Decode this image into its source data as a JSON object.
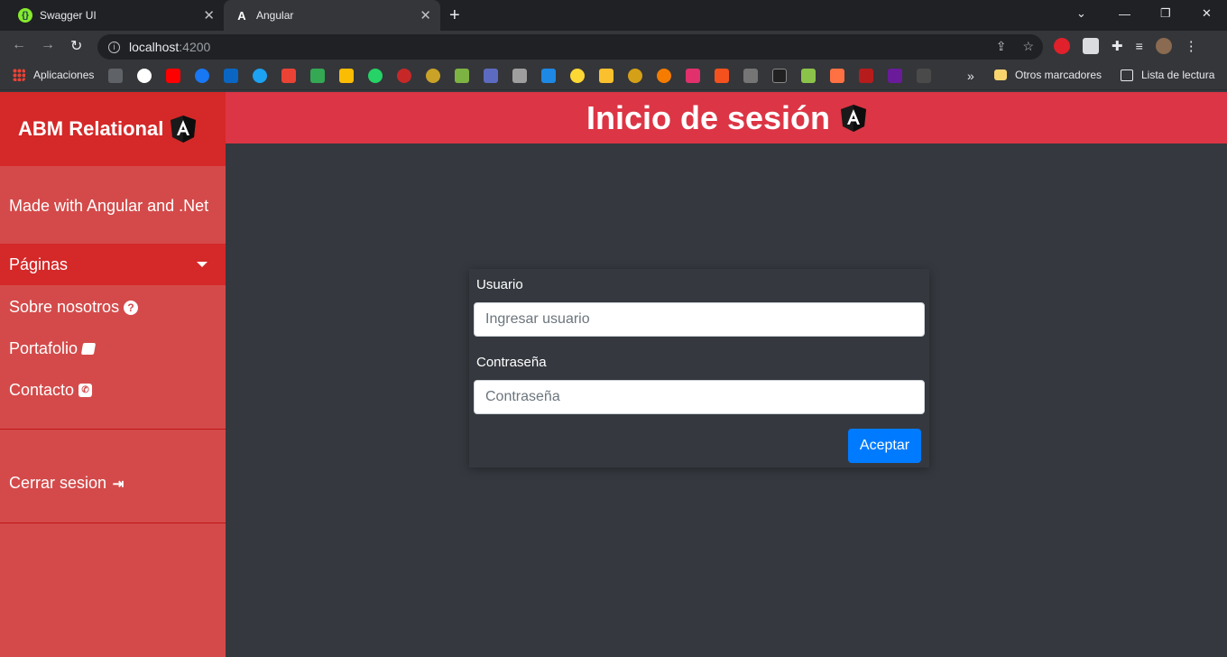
{
  "browser": {
    "tabs": [
      {
        "title": "Swagger UI",
        "active": false
      },
      {
        "title": "Angular",
        "active": true
      }
    ],
    "url_host": "localhost",
    "url_port": ":4200",
    "bookmarks": {
      "apps_label": "Aplicaciones",
      "other_label": "Otros marcadores",
      "reading_label": "Lista de lectura",
      "overflow": "»"
    }
  },
  "sidebar": {
    "brand": "ABM Relational",
    "tagline": "Made with Angular and .Net",
    "pages_label": "Páginas",
    "items": [
      {
        "label": "Sobre nosotros",
        "icon": "question-circle-icon"
      },
      {
        "label": "Portafolio",
        "icon": "book-icon"
      },
      {
        "label": "Contacto",
        "icon": "phone-icon"
      }
    ],
    "logout": "Cerrar sesion"
  },
  "header": {
    "title": "Inicio de sesión"
  },
  "login": {
    "user_label": "Usuario",
    "user_placeholder": "Ingresar usuario",
    "password_label": "Contraseña",
    "password_placeholder": "Contraseña",
    "submit": "Aceptar"
  },
  "colors": {
    "sidebar": "#d44a4a",
    "sidebar_active": "#d52828",
    "header": "#dc3545",
    "content_bg": "#35393f",
    "primary_button": "#007bff"
  }
}
